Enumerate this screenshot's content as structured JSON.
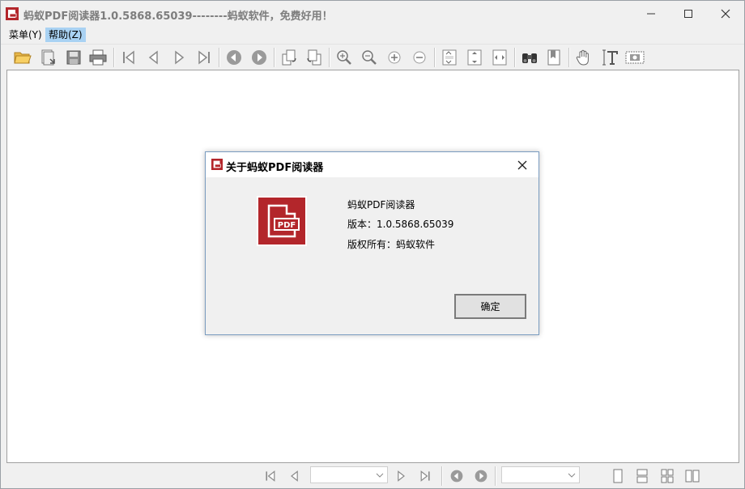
{
  "window": {
    "title": "蚂蚁PDF阅读器1.0.5868.65039--------蚂蚁软件，免费好用！",
    "icon": "pdf-app-icon",
    "controls": [
      "minimize-icon",
      "maximize-icon",
      "close-icon"
    ]
  },
  "menu": {
    "items": [
      {
        "label": "菜单(Y)",
        "active": false
      },
      {
        "label": "帮助(Z)",
        "active": true
      }
    ]
  },
  "toolbar": {
    "icons": [
      "open-folder-icon",
      "save-as-icon",
      "save-icon",
      "print-icon",
      "first-page-icon",
      "prev-page-icon",
      "next-page-icon",
      "last-page-icon",
      "back-icon",
      "forward-icon",
      "rotate-left-icon",
      "rotate-right-icon",
      "zoom-in-icon",
      "zoom-out-icon",
      "zoom-plus-icon",
      "zoom-minus-icon",
      "actual-size-icon",
      "fit-page-icon",
      "fit-width-icon",
      "find-icon",
      "bookmark-icon",
      "hand-tool-icon",
      "text-select-icon",
      "snapshot-icon"
    ]
  },
  "statusbar": {
    "page_input": "",
    "zoom_input": ""
  },
  "dialog": {
    "title": "关于蚂蚁PDF阅读器",
    "logo_text": "PDF",
    "product_name": "蚂蚁PDF阅读器",
    "version": "版本：1.0.5868.65039",
    "copyright": "版权所有：蚂蚁软件",
    "ok_label": "确定"
  },
  "colors": {
    "accent_red": "#b3262b",
    "menu_highlight": "#a9d2f3",
    "dialog_border": "#7a9cc0"
  }
}
